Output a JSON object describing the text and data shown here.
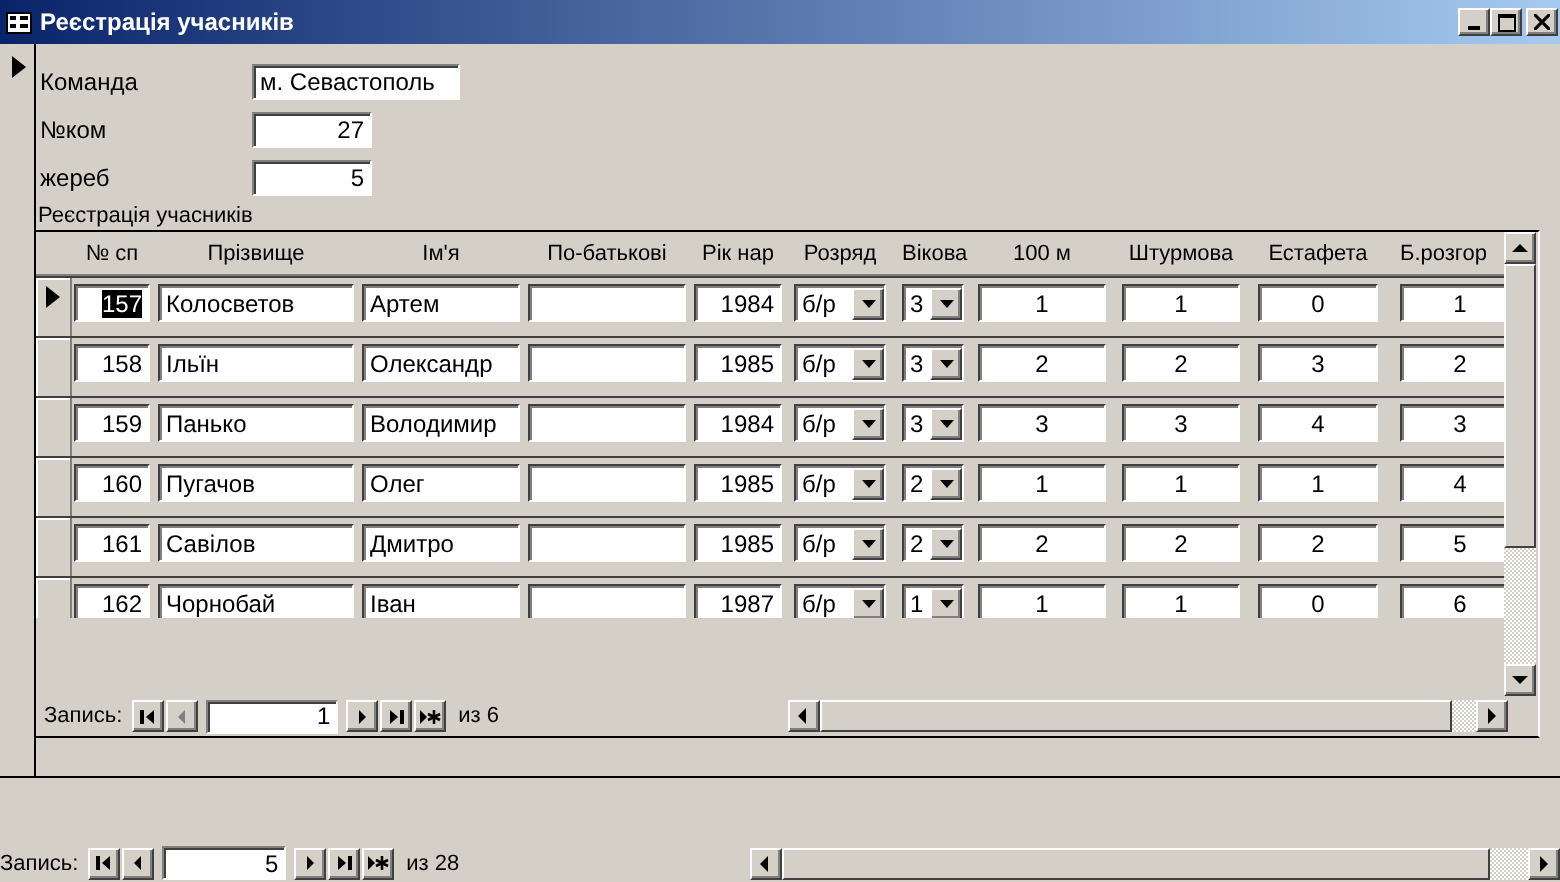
{
  "window": {
    "title": "Реєстрація учасників"
  },
  "form": {
    "selected": true,
    "fields": [
      {
        "label": "Команда",
        "value": "м. Севастополь",
        "kind": "text"
      },
      {
        "label": "№ком",
        "value": "27",
        "kind": "number"
      },
      {
        "label": "жереб",
        "value": "5",
        "kind": "number"
      }
    ]
  },
  "subform": {
    "label": "Реєстрація учасників",
    "columns": [
      {
        "label": "№ сп",
        "kind": "number"
      },
      {
        "label": "Прізвище",
        "kind": "text"
      },
      {
        "label": "Ім'я",
        "kind": "text"
      },
      {
        "label": "По-батькові",
        "kind": "text"
      },
      {
        "label": "Рік нар",
        "kind": "number"
      },
      {
        "label": "Розряд",
        "kind": "combo"
      },
      {
        "label": "Вікова",
        "kind": "combo"
      },
      {
        "label": "100 м",
        "kind": "score"
      },
      {
        "label": "Штурмова",
        "kind": "score"
      },
      {
        "label": "Естафета",
        "kind": "score"
      },
      {
        "label": "Б.розгор",
        "kind": "score"
      }
    ],
    "rows": [
      {
        "selected": true,
        "cells": [
          "157",
          "Колосветов",
          "Артем",
          "",
          "1984",
          "б/р",
          "3",
          "1",
          "1",
          "0",
          "1"
        ]
      },
      {
        "selected": false,
        "cells": [
          "158",
          "Ільїн",
          "Олександр",
          "",
          "1985",
          "б/р",
          "3",
          "2",
          "2",
          "3",
          "2"
        ]
      },
      {
        "selected": false,
        "cells": [
          "159",
          "Панько",
          "Володимир",
          "",
          "1984",
          "б/р",
          "3",
          "3",
          "3",
          "4",
          "3"
        ]
      },
      {
        "selected": false,
        "cells": [
          "160",
          "Пугачов",
          "Олег",
          "",
          "1985",
          "б/р",
          "2",
          "1",
          "1",
          "1",
          "4"
        ]
      },
      {
        "selected": false,
        "cells": [
          "161",
          "Савілов",
          "Дмитро",
          "",
          "1985",
          "б/р",
          "2",
          "2",
          "2",
          "2",
          "5"
        ]
      },
      {
        "selected": false,
        "cells": [
          "162",
          "Чорнобай",
          "Іван",
          "",
          "1987",
          "б/р",
          "1",
          "1",
          "1",
          "0",
          "6"
        ]
      }
    ],
    "nav": {
      "label": "Запись:",
      "value": "1",
      "total": "из 6",
      "buttons": [
        {
          "kind": "first",
          "disabled": false
        },
        {
          "kind": "prev",
          "disabled": true
        },
        {
          "kind": "next",
          "disabled": false
        },
        {
          "kind": "last",
          "disabled": false
        },
        {
          "kind": "new",
          "disabled": false
        }
      ]
    }
  },
  "nav": {
    "label": "Запись:",
    "value": "5",
    "total": "из 28",
    "buttons": [
      {
        "kind": "first",
        "disabled": false
      },
      {
        "kind": "prev",
        "disabled": false
      },
      {
        "kind": "next",
        "disabled": false
      },
      {
        "kind": "last",
        "disabled": false
      },
      {
        "kind": "new",
        "disabled": false
      }
    ]
  }
}
